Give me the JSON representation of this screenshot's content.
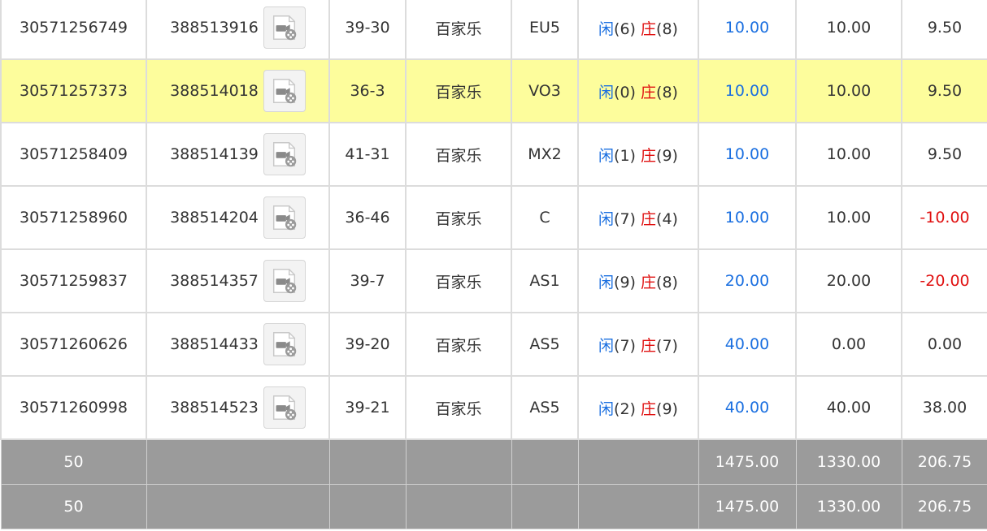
{
  "rows": [
    {
      "order_id": "30571256749",
      "round_id": "388513916",
      "table": "39-30",
      "game": "百家乐",
      "code": "EU5",
      "player_label": "闲",
      "player_val": "(6)",
      "banker_label": "庄",
      "banker_val": "(8)",
      "bet": "10.00",
      "valid": "10.00",
      "profit": "9.50",
      "profit_negative": false,
      "highlight": false
    },
    {
      "order_id": "30571257373",
      "round_id": "388514018",
      "table": "36-3",
      "game": "百家乐",
      "code": "VO3",
      "player_label": "闲",
      "player_val": "(0)",
      "banker_label": "庄",
      "banker_val": "(8)",
      "bet": "10.00",
      "valid": "10.00",
      "profit": "9.50",
      "profit_negative": false,
      "highlight": true
    },
    {
      "order_id": "30571258409",
      "round_id": "388514139",
      "table": "41-31",
      "game": "百家乐",
      "code": "MX2",
      "player_label": "闲",
      "player_val": "(1)",
      "banker_label": "庄",
      "banker_val": "(9)",
      "bet": "10.00",
      "valid": "10.00",
      "profit": "9.50",
      "profit_negative": false,
      "highlight": false
    },
    {
      "order_id": "30571258960",
      "round_id": "388514204",
      "table": "36-46",
      "game": "百家乐",
      "code": "C",
      "player_label": "闲",
      "player_val": "(7)",
      "banker_label": "庄",
      "banker_val": "(4)",
      "bet": "10.00",
      "valid": "10.00",
      "profit": "-10.00",
      "profit_negative": true,
      "highlight": false
    },
    {
      "order_id": "30571259837",
      "round_id": "388514357",
      "table": "39-7",
      "game": "百家乐",
      "code": "AS1",
      "player_label": "闲",
      "player_val": "(9)",
      "banker_label": "庄",
      "banker_val": "(8)",
      "bet": "20.00",
      "valid": "20.00",
      "profit": "-20.00",
      "profit_negative": true,
      "highlight": false
    },
    {
      "order_id": "30571260626",
      "round_id": "388514433",
      "table": "39-20",
      "game": "百家乐",
      "code": "AS5",
      "player_label": "闲",
      "player_val": "(7)",
      "banker_label": "庄",
      "banker_val": "(7)",
      "bet": "40.00",
      "valid": "0.00",
      "profit": "0.00",
      "profit_negative": false,
      "highlight": false
    },
    {
      "order_id": "30571260998",
      "round_id": "388514523",
      "table": "39-21",
      "game": "百家乐",
      "code": "AS5",
      "player_label": "闲",
      "player_val": "(2)",
      "banker_label": "庄",
      "banker_val": "(9)",
      "bet": "40.00",
      "valid": "40.00",
      "profit": "38.00",
      "profit_negative": false,
      "highlight": false
    }
  ],
  "totals": [
    {
      "count": "50",
      "bet": "1475.00",
      "valid": "1330.00",
      "profit": "206.75"
    },
    {
      "count": "50",
      "bet": "1475.00",
      "valid": "1330.00",
      "profit": "206.75"
    }
  ],
  "colors": {
    "highlight_row": "#fdfd9c",
    "total_row": "#9b9b9b",
    "bet_blue": "#1a6fe0",
    "loss_red": "#e01010"
  },
  "icons": {
    "replay": "video-replay-icon"
  }
}
